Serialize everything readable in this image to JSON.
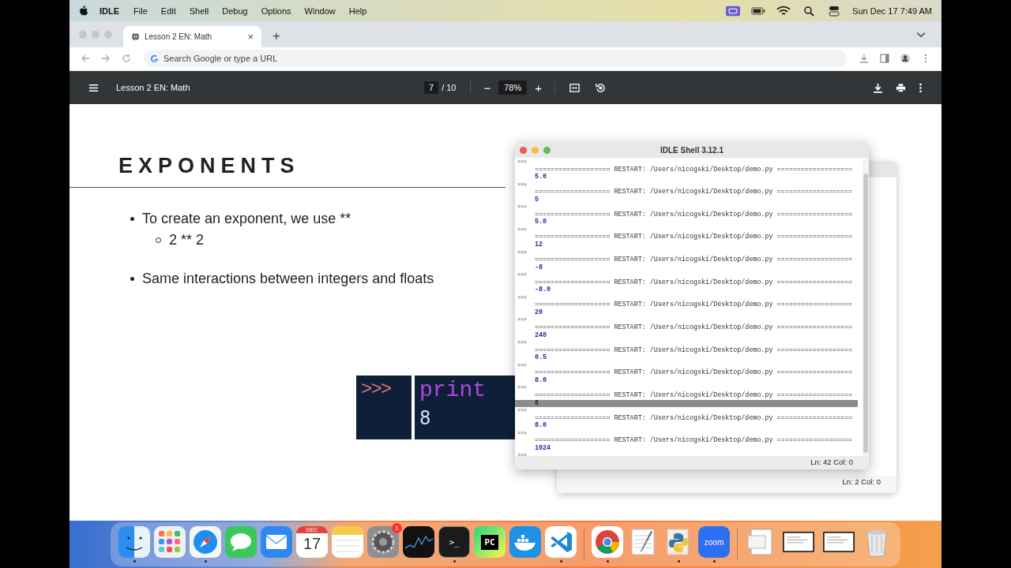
{
  "menu_bar": {
    "app": "IDLE",
    "menus": [
      "File",
      "Edit",
      "Shell",
      "Debug",
      "Options",
      "Window",
      "Help"
    ],
    "clock": "Sun Dec 17  7:49 AM"
  },
  "browser": {
    "tab": {
      "title": "Lesson 2 EN: Math",
      "close": "×",
      "selected": true
    },
    "new_tab": "+",
    "address": {
      "placeholder": "Search Google or type a URL"
    }
  },
  "pdf_toolbar": {
    "title": "Lesson 2 EN: Math",
    "page": "7",
    "page_total": "/ 10",
    "zoom_out": "−",
    "zoom": "78%",
    "zoom_in": "+"
  },
  "slide": {
    "heading": "EXPONENTS",
    "bullets": [
      {
        "text": "To create an exponent, we use **",
        "children": [
          {
            "text": "2 ** 2"
          }
        ]
      },
      {
        "text": "Same interactions between integers and floats"
      }
    ],
    "code_image": {
      "prompt": ">>>",
      "code": "print",
      "output": "8"
    }
  },
  "idle_shell": {
    "title": "IDLE Shell 3.12.1",
    "prompt": ">>>",
    "entries": [
      {
        "restart": "=================== RESTART: /Users/nicogski/Desktop/demo.py ===================",
        "output": "5.0",
        "selected": false
      },
      {
        "restart": "=================== RESTART: /Users/nicogski/Desktop/demo.py ===================",
        "output": "5",
        "selected": false
      },
      {
        "restart": "=================== RESTART: /Users/nicogski/Desktop/demo.py ===================",
        "output": "5.0",
        "selected": false
      },
      {
        "restart": "=================== RESTART: /Users/nicogski/Desktop/demo.py ===================",
        "output": "12",
        "selected": false
      },
      {
        "restart": "=================== RESTART: /Users/nicogski/Desktop/demo.py ===================",
        "output": "-8",
        "selected": false
      },
      {
        "restart": "=================== RESTART: /Users/nicogski/Desktop/demo.py ===================",
        "output": "-8.0",
        "selected": false
      },
      {
        "restart": "=================== RESTART: /Users/nicogski/Desktop/demo.py ===================",
        "output": "20",
        "selected": false
      },
      {
        "restart": "=================== RESTART: /Users/nicogski/Desktop/demo.py ===================",
        "output": "240",
        "selected": false
      },
      {
        "restart": "=================== RESTART: /Users/nicogski/Desktop/demo.py ===================",
        "output": "0.5",
        "selected": false
      },
      {
        "restart": "=================== RESTART: /Users/nicogski/Desktop/demo.py ===================",
        "output": "8.0",
        "selected": false
      },
      {
        "restart": "=================== RESTART: /Users/nicogski/Desktop/demo.py ===================",
        "output": "8",
        "selected": true
      },
      {
        "restart": "=================== RESTART: /Users/nicogski/Desktop/demo.py ===================",
        "output": "8.0",
        "selected": false
      },
      {
        "restart": "=================== RESTART: /Users/nicogski/Desktop/demo.py ===================",
        "output": "1024",
        "selected": false
      }
    ],
    "status": "Ln: 42  Col: 0"
  },
  "back_window": {
    "status": "Ln: 2  Col: 0"
  },
  "dock": [
    {
      "kind": "finder",
      "running": true
    },
    {
      "kind": "launchpad",
      "running": false
    },
    {
      "kind": "safari",
      "running": true
    },
    {
      "kind": "messages",
      "running": false
    },
    {
      "kind": "mail",
      "running": false
    },
    {
      "kind": "calendar",
      "month": "DEC",
      "day": "17",
      "running": false
    },
    {
      "kind": "notes",
      "running": false
    },
    {
      "kind": "settings",
      "badge": "1",
      "running": false
    },
    {
      "kind": "stocks",
      "running": false
    },
    {
      "kind": "terminal",
      "label": ">_",
      "running": true
    },
    {
      "kind": "pycharm",
      "label": "PC",
      "running": false
    },
    {
      "kind": "docker",
      "running": false
    },
    {
      "kind": "vscode",
      "running": true
    },
    {
      "kind": "separator"
    },
    {
      "kind": "chrome",
      "running": true
    },
    {
      "kind": "textedit",
      "running": false
    },
    {
      "kind": "python",
      "running": true
    },
    {
      "kind": "zoom",
      "label": "zoom",
      "running": true
    },
    {
      "kind": "separator"
    },
    {
      "kind": "document",
      "running": false
    },
    {
      "kind": "window",
      "running": false
    },
    {
      "kind": "window",
      "running": false
    },
    {
      "kind": "trash",
      "running": false
    }
  ]
}
